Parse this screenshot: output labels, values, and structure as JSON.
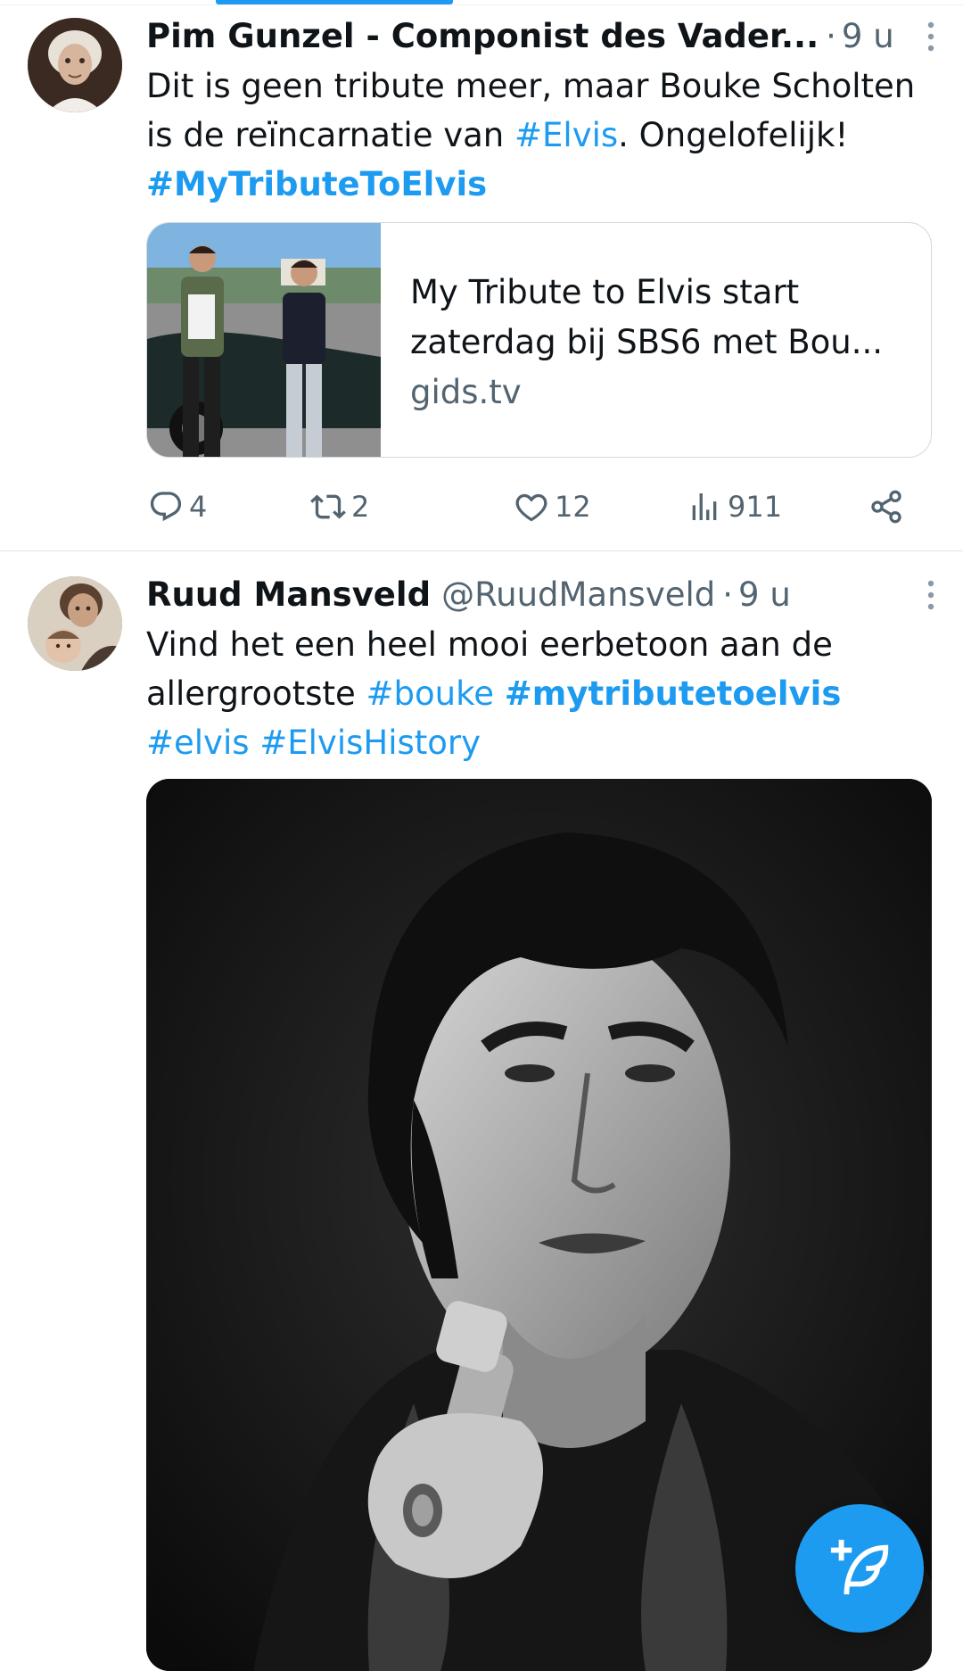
{
  "tweets": [
    {
      "author_name": "Pim Gunzel - Componist des Vader...",
      "author_handle": "",
      "time": "9 u",
      "text_parts": {
        "p1": "Dit is geen tribute meer, maar Bouke Scholten is de reïncarnatie van ",
        "tag1": "#Elvis",
        "p2": ". Ongelofelijk!",
        "tag2": "#MyTributeToElvis"
      },
      "link_card": {
        "title": "My Tribute to Elvis start zaterdag bij SBS6 met Bou...",
        "domain": "gids.tv"
      },
      "stats": {
        "replies": "4",
        "retweets": "2",
        "likes": "12",
        "views": "911"
      }
    },
    {
      "author_name": "Ruud Mansveld",
      "author_handle": "@RuudMansveld",
      "time": "9 u",
      "text_parts": {
        "p1": "Vind het een heel mooi eerbetoon aan de allergrootste ",
        "tag1": "#bouke",
        "tag2": "#mytributetoelvis",
        "tag3": "#elvis",
        "tag4": "#ElvisHistory"
      }
    }
  ],
  "colors": {
    "accent": "#1d9bf0",
    "secondary_text": "#536471",
    "primary_text": "#0f1419"
  },
  "icons": {
    "reply": "speech-bubble-icon",
    "retweet": "retweet-icon",
    "like": "heart-icon",
    "views": "bar-chart-icon",
    "share": "share-icon",
    "more": "more-vertical-icon",
    "compose": "compose-feather-icon"
  }
}
